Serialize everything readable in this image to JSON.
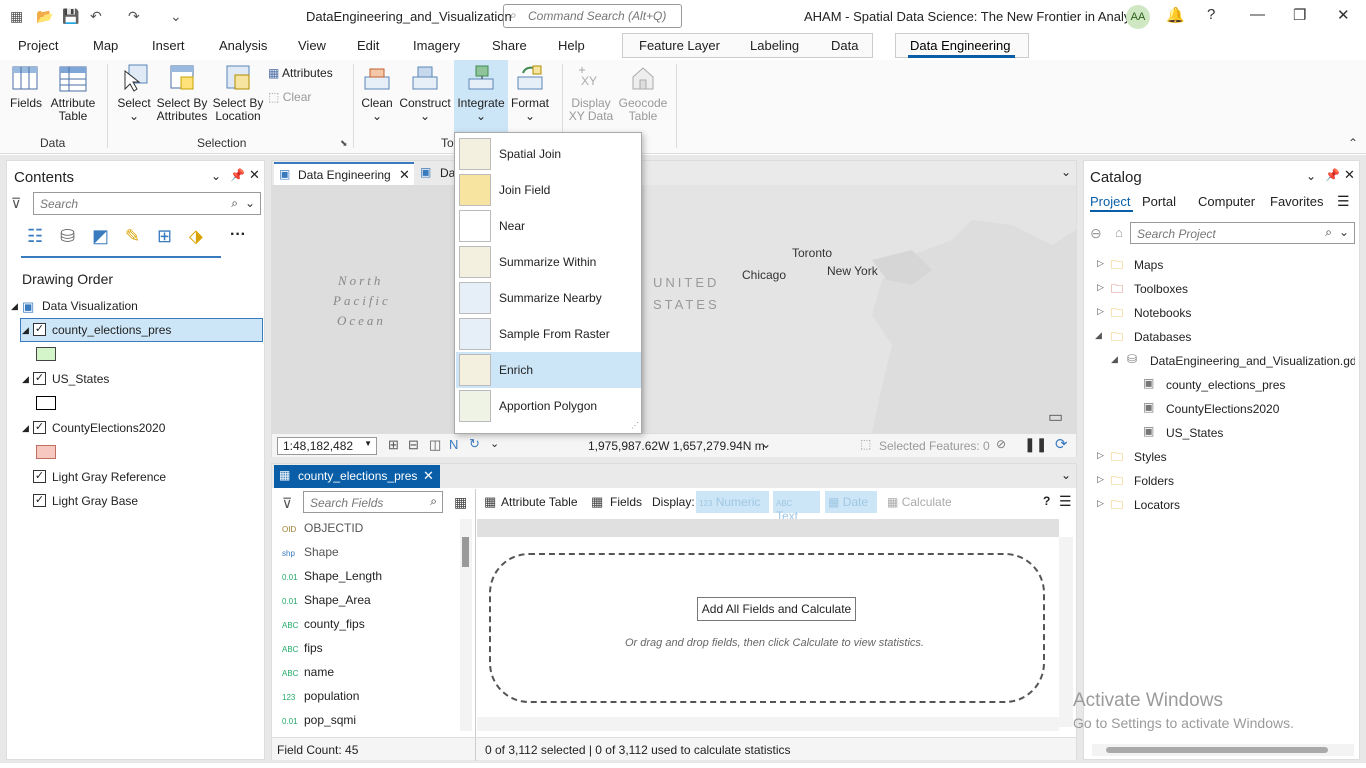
{
  "titlebar": {
    "file_name": "DataEngineering_and_Visualization",
    "search_placeholder": "Command Search (Alt+Q)",
    "project_title": "AHAM - Spatial Data Science:  The New Frontier in Analytics",
    "user_initials": "AA"
  },
  "tabs": [
    "Project",
    "Map",
    "Insert",
    "Analysis",
    "View",
    "Edit",
    "Imagery",
    "Share",
    "Help"
  ],
  "context_tabs": [
    "Feature Layer",
    "Labeling",
    "Data"
  ],
  "active_tab": "Data Engineering",
  "ribbon": {
    "data_group": {
      "label": "Data",
      "fields": "Fields",
      "attribute_table_1": "Attribute",
      "attribute_table_2": "Table"
    },
    "selection_group": {
      "label": "Selection",
      "select": "Select",
      "sba_1": "Select By",
      "sba_2": "Attributes",
      "sbl_1": "Select By",
      "sbl_2": "Location",
      "attributes": "Attributes",
      "clear": "Clear"
    },
    "tools_group": {
      "label": "To",
      "clean": "Clean",
      "construct": "Construct",
      "integrate": "Integrate",
      "format": "Format",
      "dxy_1": "Display",
      "dxy_2": "XY Data",
      "gc_1": "Geocode",
      "gc_2": "Table"
    }
  },
  "integrate_menu": [
    "Spatial Join",
    "Join Field",
    "Near",
    "Summarize Within",
    "Summarize Nearby",
    "Sample From Raster",
    "Enrich",
    "Apportion Polygon"
  ],
  "contents": {
    "title": "Contents",
    "search_placeholder": "Search",
    "drawing_order": "Drawing Order",
    "map_name": "Data Visualization",
    "layers": [
      "county_elections_pres",
      "US_States",
      "CountyElections2020",
      "Light Gray Reference",
      "Light Gray Base"
    ]
  },
  "map": {
    "tab1": "Data Engineering",
    "tab2": "Da",
    "labels": {
      "np1": "North",
      "np2": "Pacific",
      "np3": "Ocean",
      "us1": "UNITED",
      "us2": "STATES",
      "chicago": "Chicago",
      "toronto": "Toronto",
      "newyork": "New York"
    },
    "scale": "1:48,182,482",
    "coords": "1,975,987.62W 1,657,279.94N m",
    "selected": "Selected Features: 0"
  },
  "catalog": {
    "title": "Catalog",
    "tabs": [
      "Project",
      "Portal",
      "Computer",
      "Favorites"
    ],
    "search_placeholder": "Search Project",
    "items": [
      "Maps",
      "Toolboxes",
      "Notebooks",
      "Databases"
    ],
    "gdb": "DataEngineering_and_Visualization.gdb",
    "gdb_items": [
      "county_elections_pres",
      "CountyElections2020",
      "US_States"
    ],
    "more": [
      "Styles",
      "Folders",
      "Locators"
    ]
  },
  "attr": {
    "tab": "county_elections_pres",
    "search_placeholder": "Search Fields",
    "attribute_table": "Attribute Table",
    "fields": "Fields",
    "display": "Display:",
    "numeric": "Numeric",
    "text": "Text",
    "date": "Date",
    "calculate": "Calculate",
    "field_list": [
      {
        "type": "OID",
        "name": "OBJECTID"
      },
      {
        "type": "shp",
        "name": "Shape"
      },
      {
        "type": "0.01",
        "name": "Shape_Length"
      },
      {
        "type": "0.01",
        "name": "Shape_Area"
      },
      {
        "type": "ABC",
        "name": "county_fips"
      },
      {
        "type": "ABC",
        "name": "fips"
      },
      {
        "type": "ABC",
        "name": "name"
      },
      {
        "type": "123",
        "name": "population"
      },
      {
        "type": "0.01",
        "name": "pop_sqmi"
      }
    ],
    "add_button": "Add All Fields and Calculate",
    "hint": "Or drag and drop fields, then click Calculate to view statistics.",
    "field_count": "Field Count: 45",
    "status": "0 of 3,112 selected | 0 of 3,112 used to calculate statistics"
  },
  "watermark": {
    "l1": "Activate Windows",
    "l2": "Go to Settings to activate Windows."
  },
  "colors": {
    "accent": "#0a5ea8",
    "highlight": "#cde6f7",
    "land": "#dcdcdc",
    "water": "#f0f0f0"
  }
}
